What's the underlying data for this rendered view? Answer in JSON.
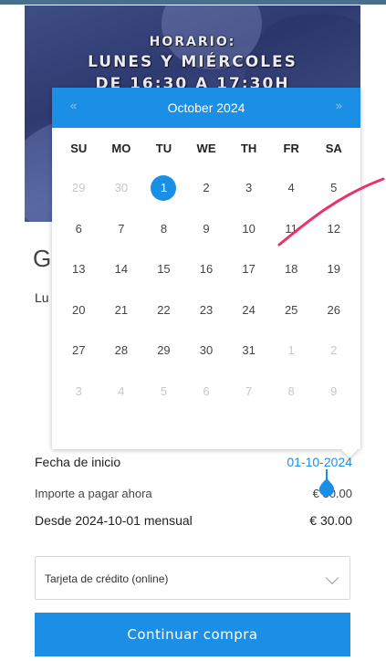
{
  "banner": {
    "line1": "HORARIO:",
    "line2": "LUNES Y MIÉRCOLES",
    "line3": "DE 16:30 A 17:30H"
  },
  "behind": {
    "heading_partial": "G",
    "text_partial": "Lu"
  },
  "calendar": {
    "prev": "«",
    "next": "»",
    "month_title": "October 2024",
    "weekdays": [
      "SU",
      "MO",
      "TU",
      "WE",
      "TH",
      "FR",
      "SA"
    ],
    "weeks": [
      [
        {
          "d": "29",
          "m": true
        },
        {
          "d": "30",
          "m": true
        },
        {
          "d": "1",
          "sel": true
        },
        {
          "d": "2"
        },
        {
          "d": "3"
        },
        {
          "d": "4"
        },
        {
          "d": "5"
        }
      ],
      [
        {
          "d": "6"
        },
        {
          "d": "7"
        },
        {
          "d": "8"
        },
        {
          "d": "9"
        },
        {
          "d": "10"
        },
        {
          "d": "11"
        },
        {
          "d": "12"
        }
      ],
      [
        {
          "d": "13"
        },
        {
          "d": "14"
        },
        {
          "d": "15"
        },
        {
          "d": "16"
        },
        {
          "d": "17"
        },
        {
          "d": "18"
        },
        {
          "d": "19"
        }
      ],
      [
        {
          "d": "20"
        },
        {
          "d": "21"
        },
        {
          "d": "22"
        },
        {
          "d": "23"
        },
        {
          "d": "24"
        },
        {
          "d": "25"
        },
        {
          "d": "26"
        }
      ],
      [
        {
          "d": "27"
        },
        {
          "d": "28"
        },
        {
          "d": "29"
        },
        {
          "d": "30"
        },
        {
          "d": "31"
        },
        {
          "d": "1",
          "m": true
        },
        {
          "d": "2",
          "m": true
        }
      ],
      [
        {
          "d": "3",
          "m": true
        },
        {
          "d": "4",
          "m": true
        },
        {
          "d": "5",
          "m": true
        },
        {
          "d": "6",
          "m": true
        },
        {
          "d": "7",
          "m": true
        },
        {
          "d": "8",
          "m": true
        },
        {
          "d": "9",
          "m": true
        }
      ]
    ]
  },
  "form": {
    "start_label": "Fecha de inicio",
    "start_value": "01-10-2024",
    "pay_now_label": "Importe a pagar ahora",
    "pay_now_value": "€ 30.00",
    "recurring_label": "Desde 2024-10-01 mensual",
    "recurring_value": "€ 30.00",
    "payment_method": "Tarjeta de crédito (online)",
    "continue_label": "Continuar compra"
  },
  "colors": {
    "accent": "#1b8fe6",
    "annotation": "#e8336a"
  }
}
